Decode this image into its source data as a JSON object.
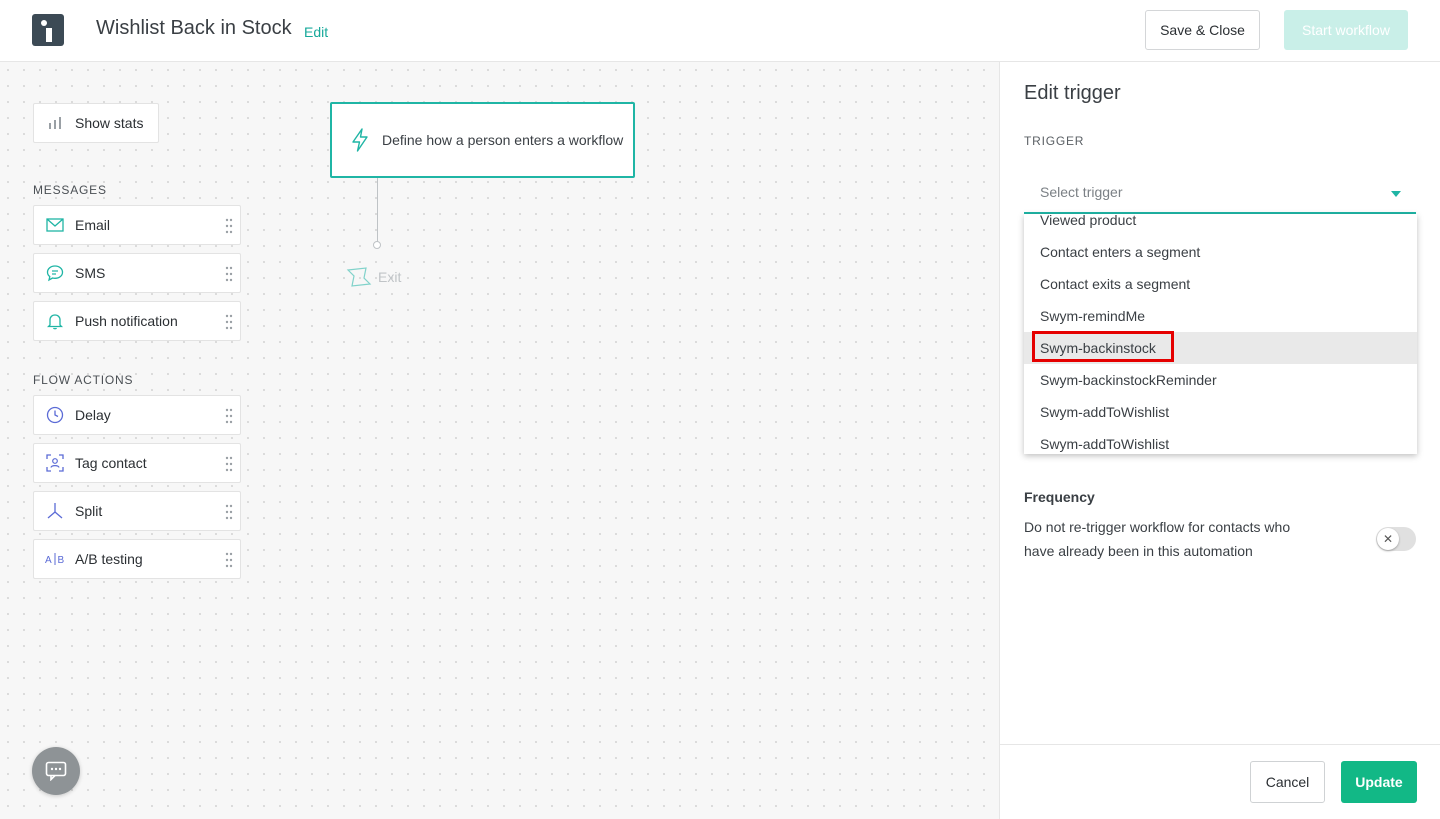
{
  "header": {
    "title": "Wishlist Back in Stock",
    "edit_label": "Edit",
    "save_close_label": "Save & Close",
    "start_workflow_label": "Start workflow"
  },
  "canvas": {
    "show_stats_label": "Show stats",
    "messages_heading": "MESSAGES",
    "messages": [
      {
        "label": "Email",
        "icon": "envelope-icon"
      },
      {
        "label": "SMS",
        "icon": "chat-bubble-icon"
      },
      {
        "label": "Push notification",
        "icon": "bell-icon"
      }
    ],
    "flow_actions_heading": "FLOW ACTIONS",
    "flow_actions": [
      {
        "label": "Delay",
        "icon": "clock-icon"
      },
      {
        "label": "Tag contact",
        "icon": "tag-contact-icon"
      },
      {
        "label": "Split",
        "icon": "split-icon"
      },
      {
        "label": "A/B testing",
        "icon": "ab-icon"
      }
    ],
    "trigger_node_label": "Define how a person enters a workflow",
    "exit_label": "Exit"
  },
  "panel": {
    "title": "Edit trigger",
    "trigger_heading": "TRIGGER",
    "select_placeholder": "Select trigger",
    "options": [
      "Viewed product",
      "Contact enters a segment",
      "Contact exits a segment",
      "Swym-remindMe",
      "Swym-backinstock",
      "Swym-backinstockReminder",
      "Swym-addToWishlist",
      "Swym-addToWishlist"
    ],
    "selected_option": "Swym-backinstock",
    "frequency_title": "Frequency",
    "frequency_text": "Do not re-trigger workflow for contacts who have already been in this automation",
    "toggle_on": false,
    "cancel_label": "Cancel",
    "update_label": "Update"
  },
  "colors": {
    "accent": "#1fb5a5",
    "update_button": "#12b886",
    "highlight_box": "#e50000"
  }
}
